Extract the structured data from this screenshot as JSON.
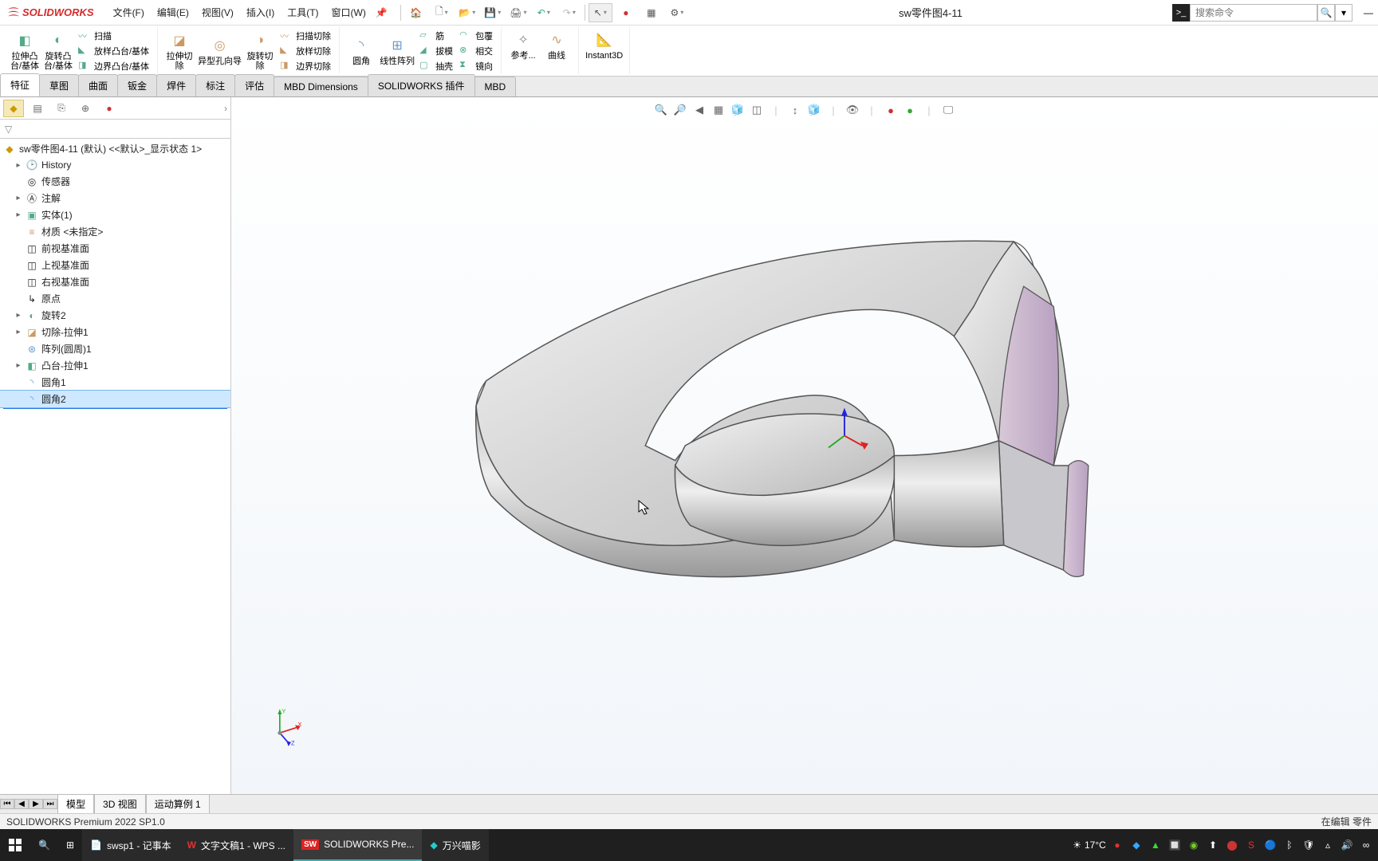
{
  "app": {
    "name": "SOLIDWORKS",
    "doc_title": "sw零件图4-11"
  },
  "menu": {
    "file": "文件(F)",
    "edit": "编辑(E)",
    "view": "视图(V)",
    "insert": "插入(I)",
    "tools": "工具(T)",
    "window": "窗口(W)"
  },
  "search": {
    "placeholder": "搜索命令"
  },
  "ribbon": {
    "extrude": "拉伸凸\n台/基体",
    "revolve": "旋转凸\n台/基体",
    "sweep": "扫描",
    "loft": "放样凸台/基体",
    "boundary": "边界凸台/基体",
    "extrudeCut": "拉伸切\n除",
    "hole": "异型孔向导",
    "revolveCut": "旋转切\n除",
    "sweepCut": "扫描切除",
    "loftCut": "放样切除",
    "boundaryCut": "边界切除",
    "fillet": "圆角",
    "linear": "线性阵列",
    "rib": "筋",
    "draft": "拔模",
    "shell": "抽壳",
    "wrap": "包覆",
    "intersect": "相交",
    "mirror": "镜向",
    "refgeo": "参考...",
    "curves": "曲线",
    "instant": "Instant3D"
  },
  "tabs": {
    "feature": "特征",
    "sketch": "草图",
    "surface": "曲面",
    "sheetmetal": "钣金",
    "weldment": "焊件",
    "annotate": "标注",
    "evaluate": "评估",
    "mbddim": "MBD Dimensions",
    "plugin": "SOLIDWORKS 插件",
    "mbd": "MBD"
  },
  "tree": {
    "root": "sw零件图4-11 (默认) <<默认>_显示状态 1>",
    "history": "History",
    "sensors": "传感器",
    "annotations": "注解",
    "solid": "实体(1)",
    "material": "材质 <未指定>",
    "front": "前视基准面",
    "top": "上视基准面",
    "right": "右视基准面",
    "origin": "原点",
    "revolve2": "旋转2",
    "cutext1": "切除-拉伸1",
    "pattern": "阵列(圆周)1",
    "bossext1": "凸台-拉伸1",
    "fillet1": "圆角1",
    "fillet2": "圆角2"
  },
  "bottomtabs": {
    "model": "模型",
    "view3d": "3D 视图",
    "motion": "运动算例 1"
  },
  "status": {
    "left": "SOLIDWORKS Premium 2022 SP1.0",
    "right": "在编辑 零件"
  },
  "taskbar": {
    "notepad": "swsp1 - 记事本",
    "wps": "文字文稿1 - WPS ...",
    "sw": "SOLIDWORKS Pre...",
    "wx": "万兴喵影",
    "temp": "17°C"
  }
}
